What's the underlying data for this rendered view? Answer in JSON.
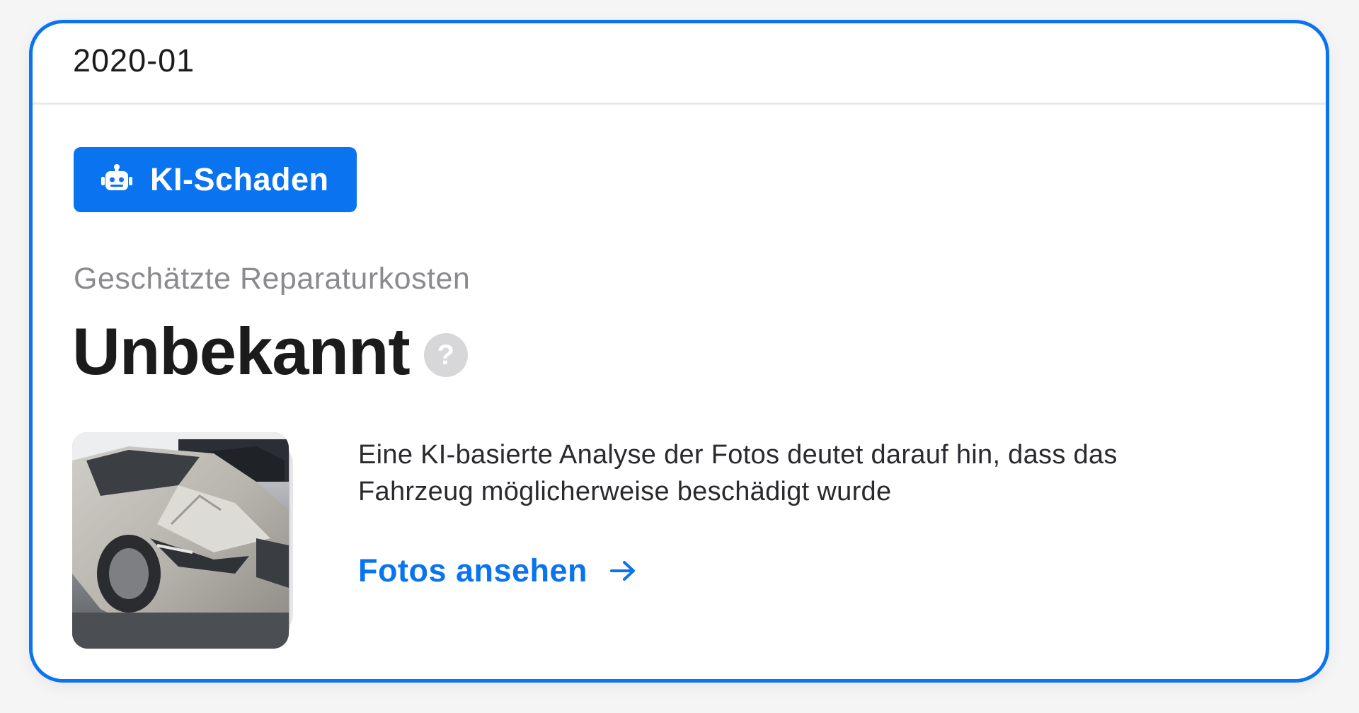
{
  "header": {
    "date": "2020-01"
  },
  "badge": {
    "label": "KI-Schaden",
    "icon": "robot-icon",
    "color": "#0a74f0"
  },
  "cost": {
    "label": "Geschätzte Reparaturkosten",
    "value": "Unbekannt",
    "help_icon": "question-mark-icon"
  },
  "analysis": {
    "description": "Eine KI-basierte Analyse der Fotos deutet darauf hin, dass das Fahrzeug möglicherweise beschädigt wurde",
    "link_label": "Fotos ansehen",
    "link_icon": "arrow-right-icon",
    "thumbnail": "damaged-car-photo"
  },
  "colors": {
    "accent": "#0a74f0",
    "muted_text": "#8a8a8f",
    "primary_text": "#1b1b1b"
  }
}
